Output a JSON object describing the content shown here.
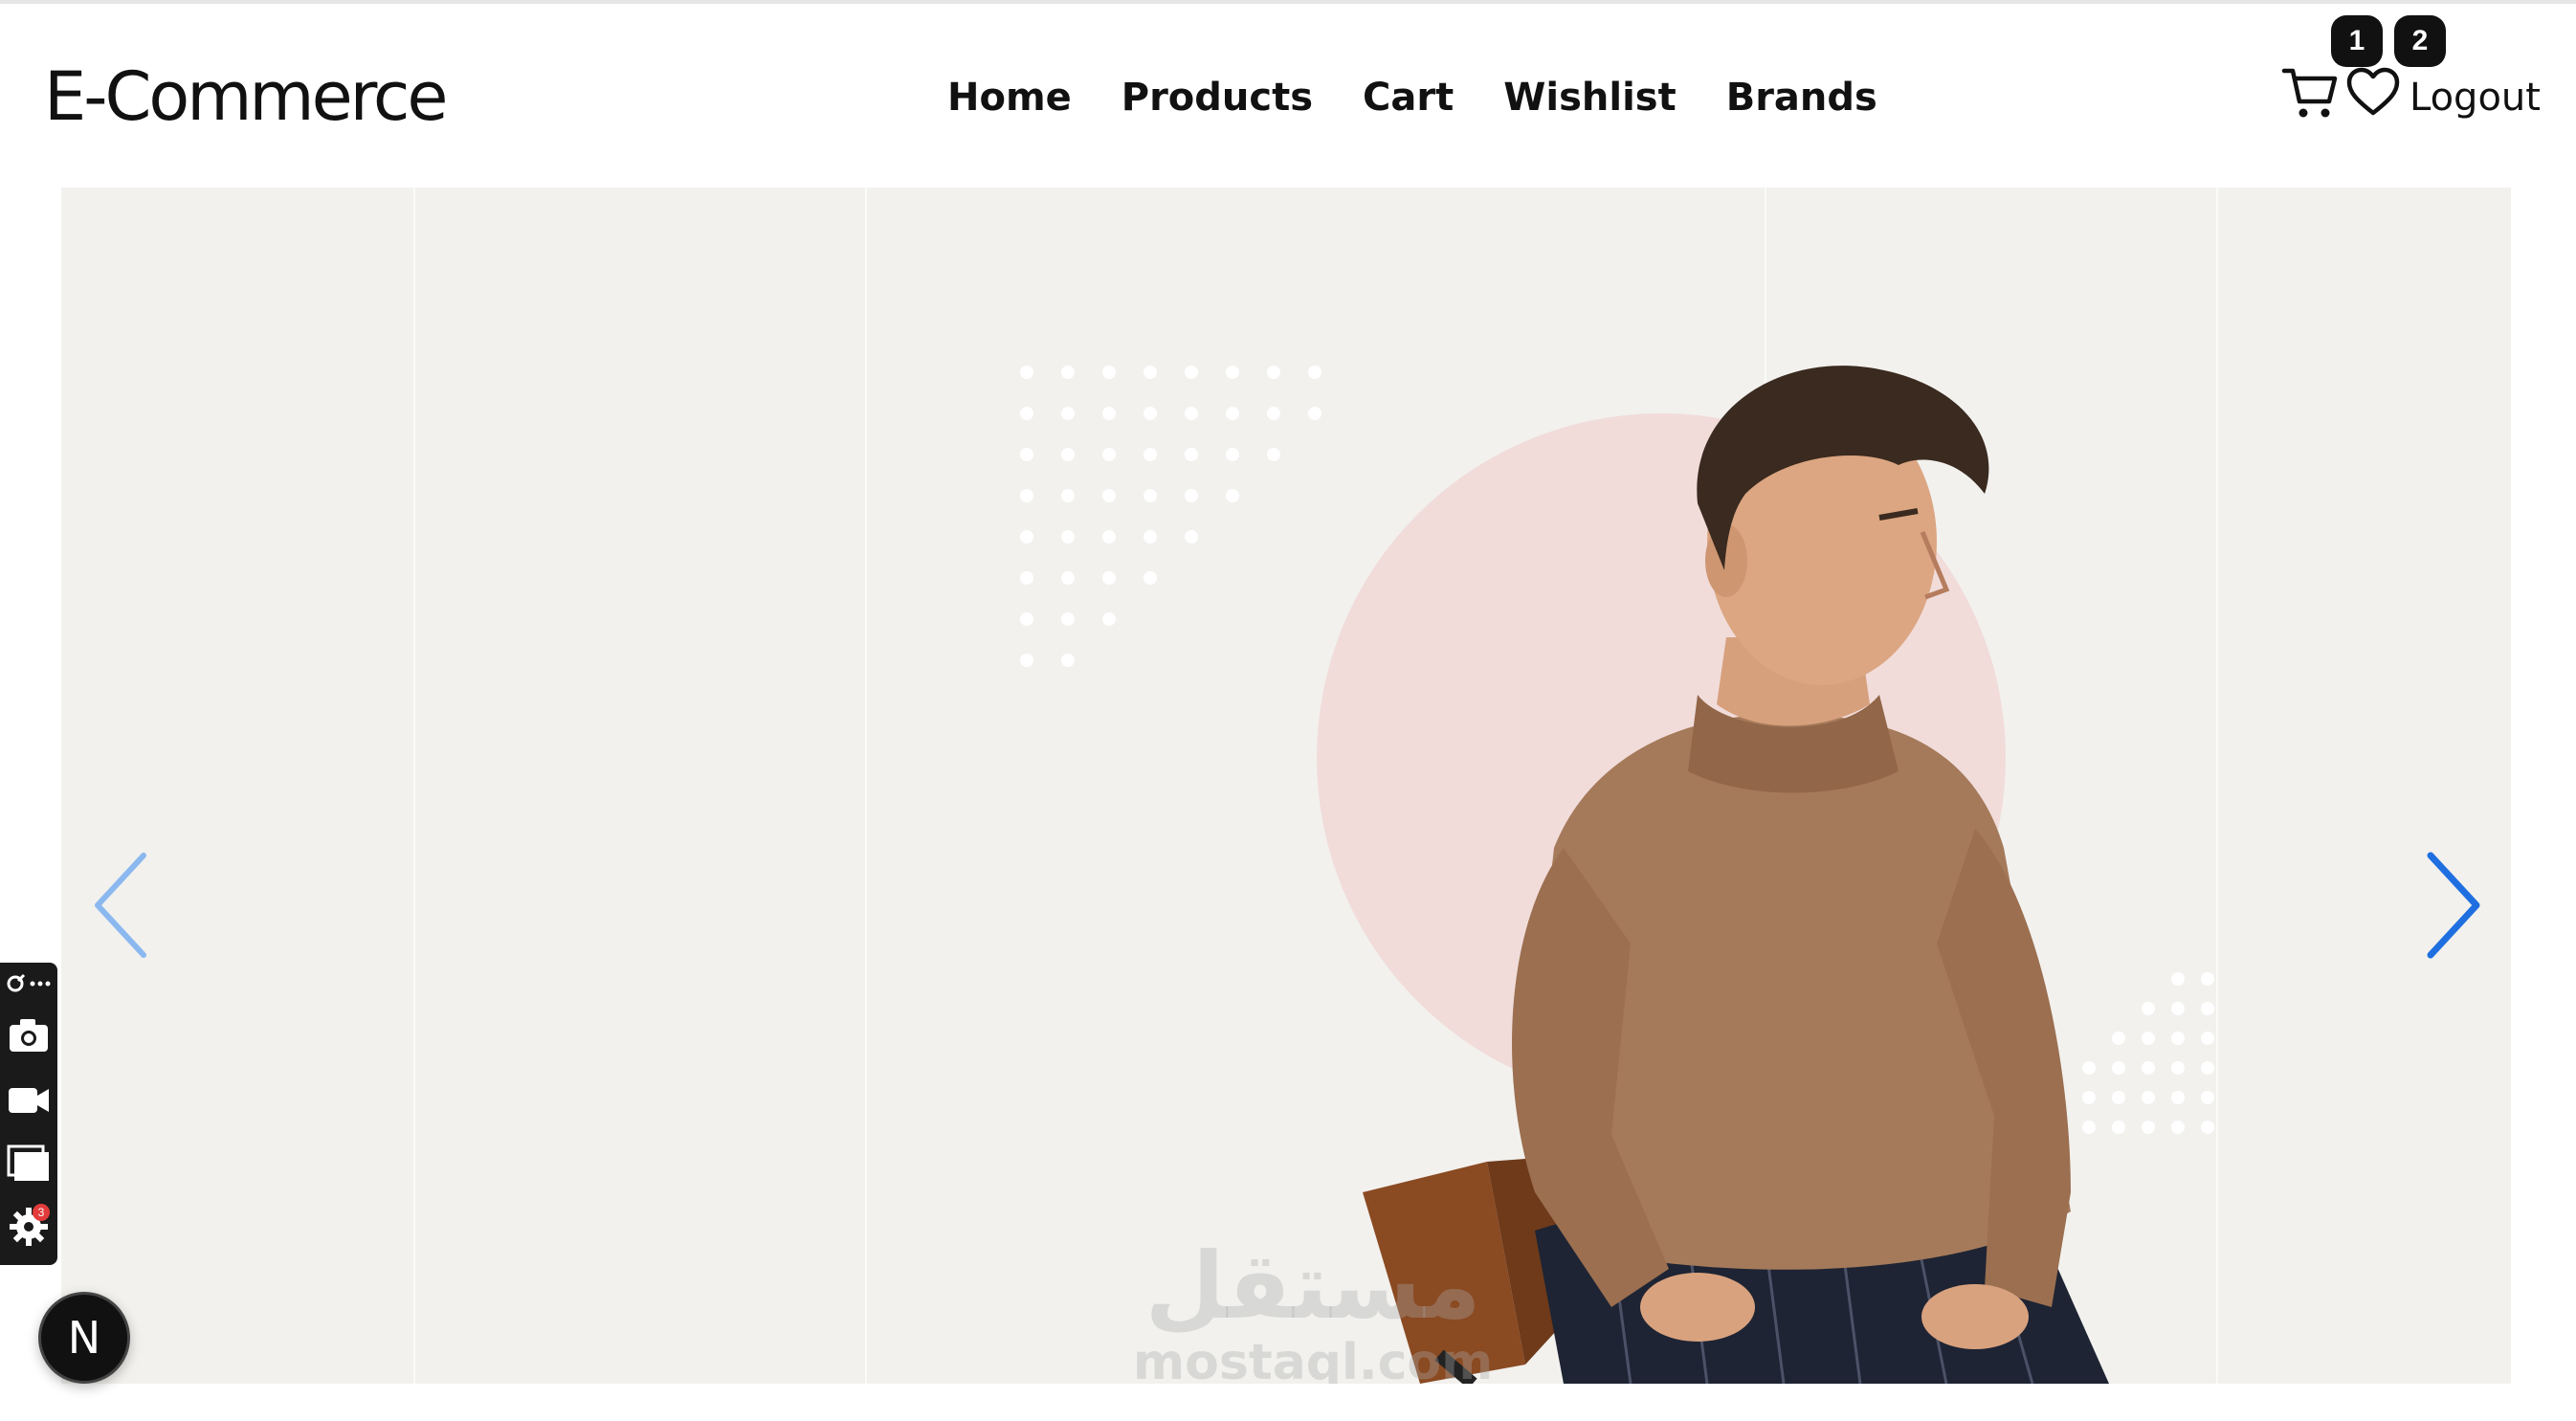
{
  "navbar": {
    "brand": "E-Commerce",
    "links": [
      "Home",
      "Products",
      "Cart",
      "Wishlist",
      "Brands"
    ],
    "cart_count": "1",
    "wishlist_count": "2",
    "logout": "Logout"
  },
  "slider": {
    "prev_icon": "chevron-left-icon",
    "next_icon": "chevron-right-icon"
  },
  "watermark": {
    "arabic": "مستقل",
    "latin": "mostaql.com"
  },
  "devtools": {
    "settings_badge": "3",
    "fab_letter": "N"
  },
  "colors": {
    "accent_arrow": "#1f6fe0",
    "hero_bg": "#f2f1ee",
    "circle": "#f1dcda",
    "sweater": "#a57a5a"
  }
}
